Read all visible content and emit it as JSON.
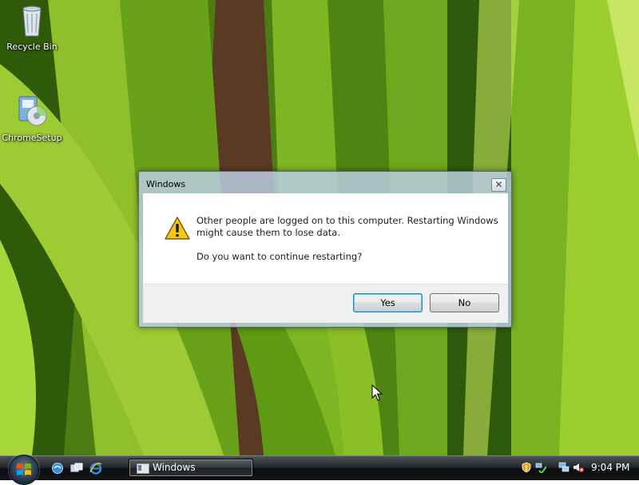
{
  "desktop": {
    "icons": [
      {
        "label": "Recycle Bin",
        "icon": "recycle-bin-icon"
      },
      {
        "label": "ChromeSetup",
        "icon": "installer-icon"
      }
    ]
  },
  "dialog": {
    "title": "Windows",
    "close_glyph": "✕",
    "icon": "warning-icon",
    "message_line1": "Other people are logged on to this computer. Restarting Windows might cause them to lose data.",
    "message_line2": "Do you want to continue restarting?",
    "yes_label": "Yes",
    "no_label": "No"
  },
  "taskbar": {
    "start": "windows-start-icon",
    "quick_launch": [
      "ie-icon",
      "switch-windows-icon",
      "internet-explorer-icon"
    ],
    "active_task": {
      "label": "Windows",
      "icon": "window-icon"
    },
    "tray": {
      "icons": [
        "security-shield-icon",
        "network-icon",
        "network-alert-icon",
        "volume-mute-icon"
      ],
      "clock": "9:04 PM"
    }
  },
  "colors": {
    "wallpaper_green": "#5b8a16",
    "dialog_frame": "#b9cde1",
    "taskbar": "#1f2327",
    "warning_yellow": "#f5c518"
  }
}
